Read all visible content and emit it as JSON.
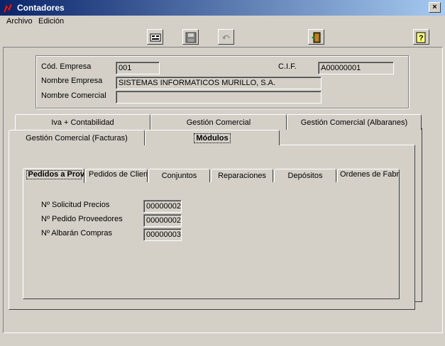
{
  "window": {
    "title": "Contadores",
    "close_glyph": "×",
    "app_icon": "app-icon"
  },
  "menu": [
    {
      "label": "Archivo"
    },
    {
      "label": "Edición"
    }
  ],
  "toolbar": [
    {
      "name": "form-view-icon"
    },
    {
      "name": "save-icon"
    },
    {
      "name": "undo-icon"
    },
    {
      "name": "exit-door-icon"
    },
    {
      "name": "help-icon"
    }
  ],
  "company": {
    "cod_label": "Cód. Empresa",
    "cod_value": "001",
    "cif_label": "C.I.F.",
    "cif_value": "A00000001",
    "nombre_label": "Nombre Empresa",
    "nombre_value": "SISTEMAS INFORMATICOS MURILLO, S.A.",
    "comercial_label": "Nombre Comercial",
    "comercial_value": ""
  },
  "tabs_row1": [
    {
      "label": "Iva + Contabilidad"
    },
    {
      "label": "Gestión Comercial"
    },
    {
      "label": "Gestión Comercial  (Albaranes)"
    }
  ],
  "tabs_row2": [
    {
      "label": "Gestión Comercial  (Facturas)"
    },
    {
      "label": "Módulos",
      "active": true
    }
  ],
  "subtabs": [
    {
      "label": "Pedidos a Proveedores",
      "active": true
    },
    {
      "label": "Pedidos de Clientes"
    },
    {
      "label": "Conjuntos"
    },
    {
      "label": "Reparaciones"
    },
    {
      "label": "Depósitos"
    },
    {
      "label": "Ordenes de Fabricación"
    }
  ],
  "counters": [
    {
      "label": "Nº Solicitud Precios",
      "value": "00000002"
    },
    {
      "label": "Nº Pedido Proveedores",
      "value": "00000002"
    },
    {
      "label": "Nº Albarán Compras",
      "value": "00000003"
    }
  ]
}
